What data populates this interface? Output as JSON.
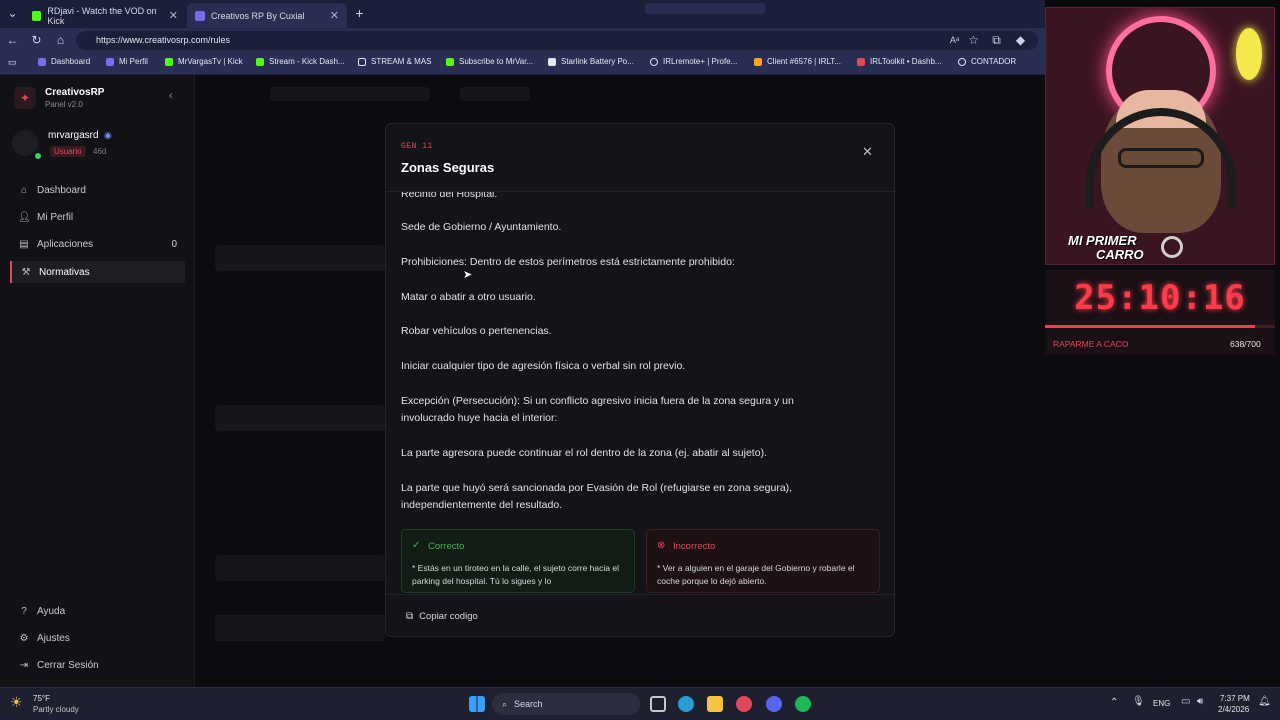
{
  "browser": {
    "tabs": [
      {
        "label": "RDjavi - Watch the VOD on Kick"
      },
      {
        "label": "Creativos RP By Cuxial"
      }
    ],
    "url": "https://www.creativosrp.com/rules",
    "bookmarks": [
      "Dashboard",
      "Mi Perfil",
      "MrVargasTv | Kick",
      "Stream - Kick Dash...",
      "STREAM & MAS",
      "Subscribe to MrVar...",
      "Starlink Battery Po...",
      "IRLremote+ | Profe...",
      "Client #6576 | IRLT...",
      "IRLToolkit • Dashb...",
      "CONTADOR"
    ]
  },
  "app": {
    "brand": {
      "name": "CreativosRP",
      "version": "Panel v2.0"
    },
    "user": {
      "name": "mrvargasrd",
      "role": "Usuario",
      "age": "46d"
    },
    "nav": [
      {
        "label": "Dashboard",
        "icon": "home-icon",
        "badge": ""
      },
      {
        "label": "Mi Perfil",
        "icon": "user-icon",
        "badge": ""
      },
      {
        "label": "Aplicaciones",
        "icon": "document-icon",
        "badge": "0"
      },
      {
        "label": "Normativas",
        "icon": "gavel-icon",
        "badge": ""
      }
    ],
    "footer_nav": [
      {
        "label": "Ayuda",
        "icon": "help-icon"
      },
      {
        "label": "Ajustes",
        "icon": "gear-icon"
      },
      {
        "label": "Cerrar Sesión",
        "icon": "logout-icon"
      }
    ]
  },
  "modal": {
    "category": "GEN 11",
    "title": "Zonas Seguras",
    "partial_line": "Recinto del Hospital.",
    "paragraphs": [
      "Sede de Gobierno / Ayuntamiento.",
      "Prohibiciones: Dentro de estos perímetros está estrictamente prohibido:",
      "Matar o abatir a otro usuario.",
      "Robar vehículos o pertenencias.",
      "Iniciar cualquier tipo de agresión física o verbal sin rol previo.",
      "Excepción (Persecución): Si un conflicto agresivo inicia fuera de la zona segura y un involucrado huye hacia el interior:",
      "La parte agresora puede continuar el rol dentro de la zona (ej. abatir al sujeto).",
      "La parte que huyó será sancionada por Evasión de Rol (refugiarse en zona segura), independientemente del resultado."
    ],
    "correct": {
      "label": "Correcto",
      "text": "* Estás en un tiroteo en la calle, el sujeto corre hacia el parking del hospital. Tú lo sigues y lo"
    },
    "incorrect": {
      "label": "Incorrecto",
      "text": "* Ver a alguien en el garaje del Gobierno y robarle el coche porque lo dejó abierto."
    },
    "copy_button": "Copiar codigo"
  },
  "overlay": {
    "cam_caption_line1": "MI PRIMER",
    "cam_caption_line2": "CARRO",
    "timer": "25:10:16",
    "progress_label": "RAPARME A CACO",
    "progress_count": "638/700",
    "progress_fraction": 0.911
  },
  "taskbar": {
    "weather_temp": "75°F",
    "weather_desc": "Partly cloudy",
    "search": "Search",
    "lang": "ENG",
    "time": "7:37 PM",
    "date": "2/4/2026"
  },
  "colors": {
    "accent": "#e0485a",
    "correct": "#4caf50",
    "incorrect": "#e0485a",
    "timer_red": "#ff3b4a"
  }
}
